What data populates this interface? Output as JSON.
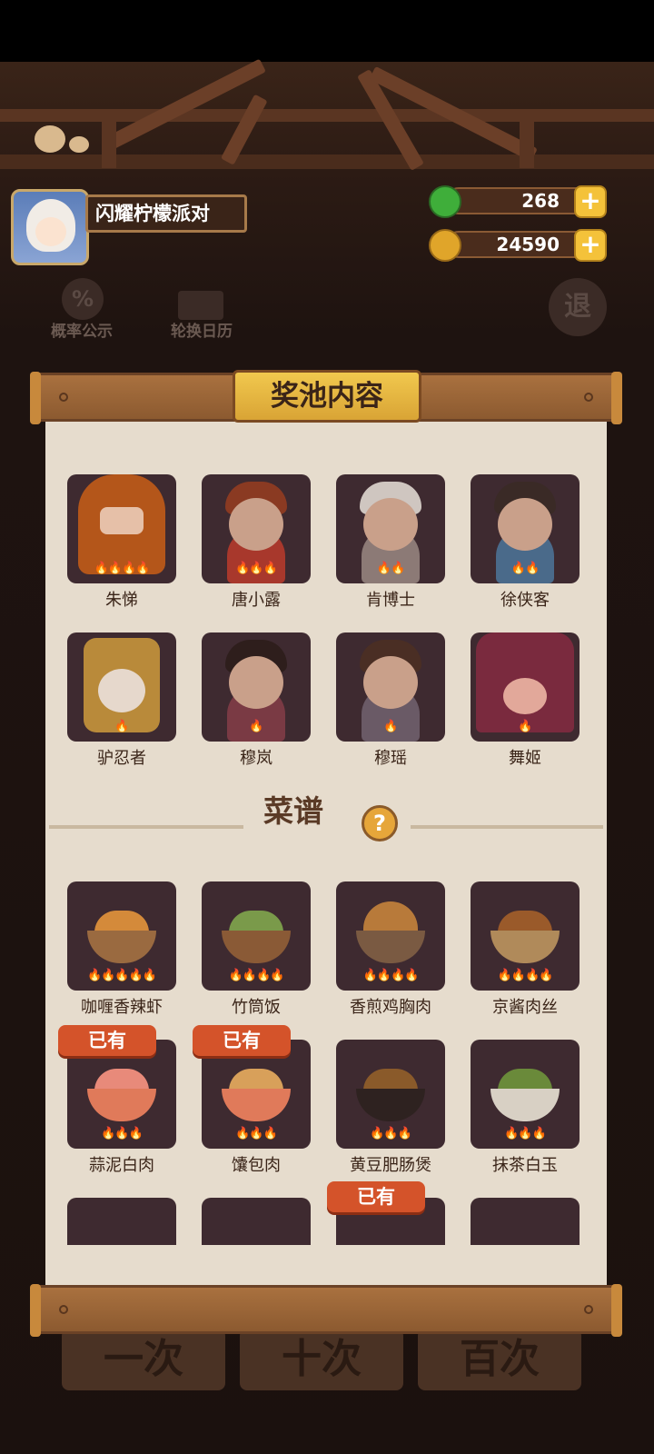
{
  "player": {
    "name": "闪耀柠檬派对"
  },
  "currency": {
    "jade": "268",
    "coins": "24590",
    "plus": "+"
  },
  "top_buttons": {
    "rate": {
      "icon_text": "%",
      "label": "概率公示"
    },
    "calendar": {
      "label": "轮换日历"
    },
    "exit": {
      "label": "退"
    }
  },
  "panel": {
    "title": "奖池内容"
  },
  "characters": [
    {
      "name": "朱悌",
      "flames": "🔥🔥🔥🔥"
    },
    {
      "name": "唐小露",
      "flames": "🔥🔥🔥"
    },
    {
      "name": "肯博士",
      "flames": "🔥🔥"
    },
    {
      "name": "徐侠客",
      "flames": "🔥🔥"
    },
    {
      "name": "驴忍者",
      "flames": "🔥"
    },
    {
      "name": "穆岚",
      "flames": "🔥"
    },
    {
      "name": "穆瑶",
      "flames": "🔥"
    },
    {
      "name": "舞姬",
      "flames": "🔥"
    }
  ],
  "recipe_section": {
    "title": "菜谱",
    "help": "?"
  },
  "recipes": [
    {
      "name": "咖喱香辣虾",
      "flames": "🔥🔥🔥🔥🔥"
    },
    {
      "name": "竹筒饭",
      "flames": "🔥🔥🔥🔥"
    },
    {
      "name": "香煎鸡胸肉",
      "flames": "🔥🔥🔥🔥"
    },
    {
      "name": "京酱肉丝",
      "flames": "🔥🔥🔥🔥"
    },
    {
      "name": "蒜泥白肉",
      "flames": "🔥🔥🔥"
    },
    {
      "name": "馕包肉",
      "flames": "🔥🔥🔥"
    },
    {
      "name": "黄豆肥肠煲",
      "flames": "🔥🔥🔥"
    },
    {
      "name": "抹茶白玉",
      "flames": "🔥🔥🔥"
    }
  ],
  "owned_label": "已有",
  "bottom_buttons": {
    "one": "一次",
    "ten": "十次",
    "hundred": "百次"
  },
  "colors": {
    "owned_badge": "#d4532a",
    "title_gold": "#f1c84e",
    "card_bg": "#3e2a30"
  }
}
